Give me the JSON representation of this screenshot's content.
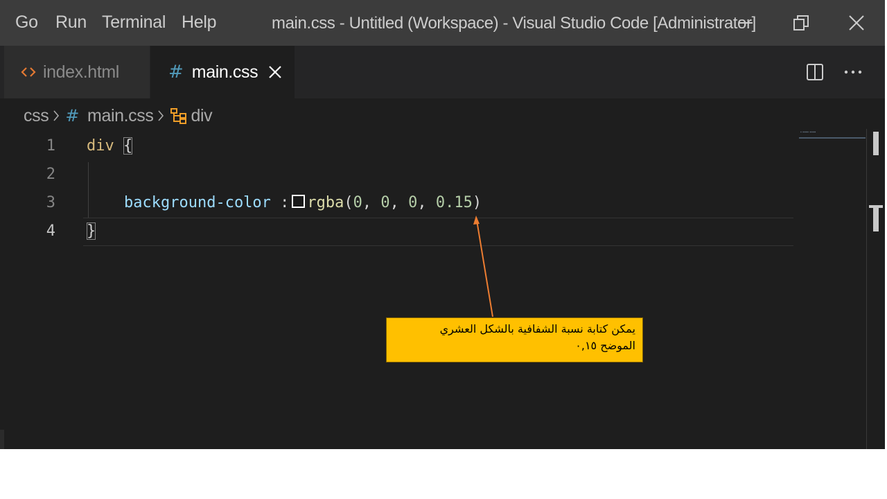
{
  "titlebar": {
    "menu": [
      "Go",
      "Run",
      "Terminal",
      "Help"
    ],
    "title": "main.css - Untitled (Workspace) - Visual Studio Code [Administrator]",
    "controls": [
      "minimize",
      "restore",
      "close"
    ]
  },
  "tabs": [
    {
      "label": "index.html",
      "icon": "html-brackets-icon",
      "active": false
    },
    {
      "label": "main.css",
      "icon": "hash-icon",
      "active": true
    }
  ],
  "breadcrumb": {
    "folder": "css",
    "file": "main.css",
    "symbol": "div"
  },
  "editor": {
    "line_numbers": [
      "1",
      "2",
      "3",
      "4"
    ],
    "line1": {
      "selector": "div",
      "brace": "{"
    },
    "line3": {
      "property": "background-color",
      "colon": " :",
      "func": "rgba",
      "open": "(",
      "n1": "0",
      "n2": "0",
      "n3": "0",
      "n4": "0.15",
      "sep": ", ",
      "close": ")"
    },
    "line4": {
      "brace": "}"
    }
  },
  "annotation": {
    "line1": "يمكن كتابة نسبة الشفافية بالشكل العشري",
    "line2": "الموضح ٠,١٥",
    "arrow_color": "#ed7d31",
    "box_color": "#ffc000"
  },
  "colors": {
    "titlebar": "#3c3c3c",
    "editor_bg": "#1e1e1e",
    "selector": "#d7ba7d",
    "property": "#9cdcfe",
    "function": "#dcdcaa",
    "number": "#b5cea8"
  }
}
